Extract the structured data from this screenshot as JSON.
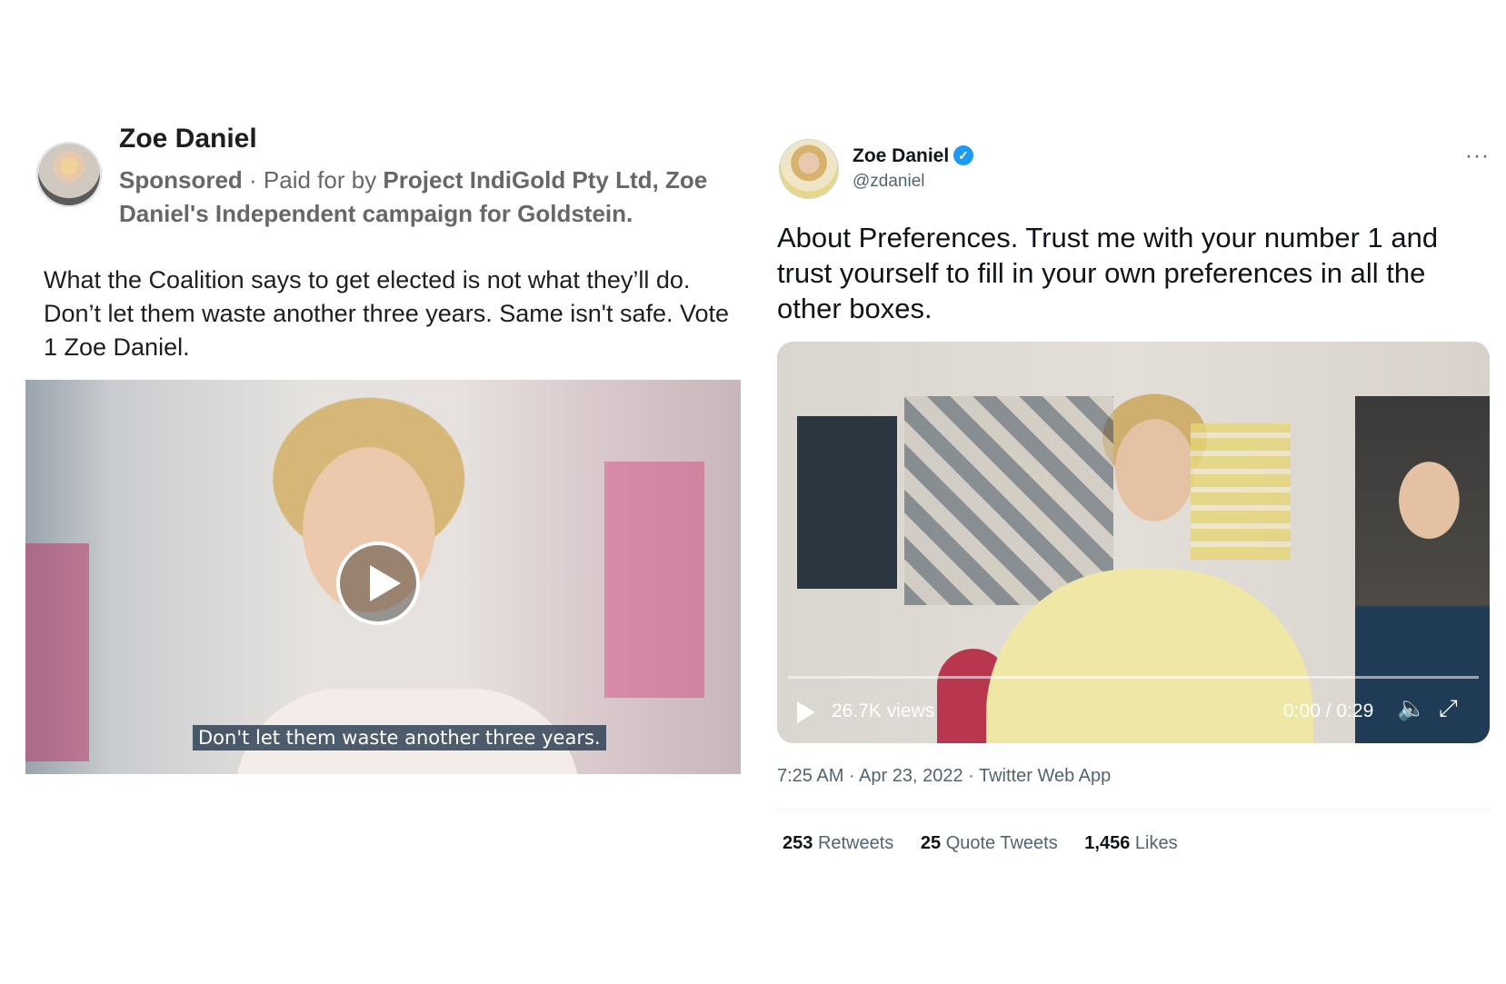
{
  "facebook_post": {
    "author": "Zoe Daniel",
    "sponsored": "Sponsored",
    "paid_prefix": " · Paid for by ",
    "paid_for_by": "Project IndiGold Pty Ltd, Zoe Daniel's Independent campaign for Goldstein.",
    "body": "What the Coalition says to get elected is not what they’ll do. Don’t let them waste another three years. Same isn't safe. Vote 1 Zoe Daniel.",
    "video_caption": "Don't let them waste another three years.",
    "icons": {
      "play": "play-icon"
    }
  },
  "tweet": {
    "name": "Zoe Daniel",
    "handle": "@zdaniel",
    "verified_glyph": "✓",
    "more_label": "···",
    "text": "About Preferences. Trust me with your number 1 and trust yourself to fill in your own preferences in all the other boxes.",
    "video": {
      "views": "26.7K views",
      "time": "0:00 / 0:29",
      "progress": 0
    },
    "meta": "7:25 AM · Apr 23, 2022 · Twitter Web App",
    "stats": [
      {
        "count": "253",
        "label": "Retweets"
      },
      {
        "count": "25",
        "label": "Quote Tweets"
      },
      {
        "count": "1,456",
        "label": "Likes"
      }
    ],
    "colors": {
      "verified": "#1d9bf0",
      "text": "#0f1419",
      "muted": "#536471"
    },
    "icons": {
      "play": "play-icon",
      "volume": "volume-icon",
      "fullscreen": "fullscreen-icon",
      "verified": "verified-badge-icon",
      "more": "more-icon"
    }
  }
}
